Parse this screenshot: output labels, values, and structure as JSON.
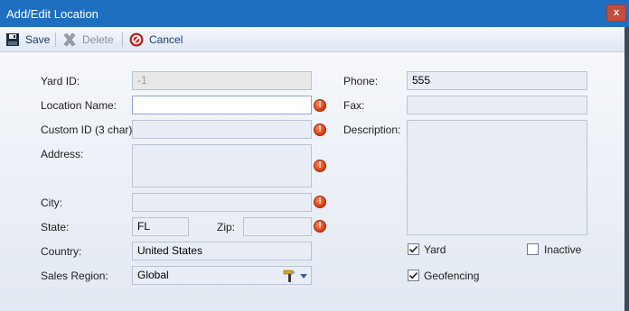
{
  "window": {
    "title": "Add/Edit Location",
    "close_label": "x"
  },
  "toolbar": {
    "save_label": "Save",
    "delete_label": "Delete",
    "cancel_label": "Cancel"
  },
  "form": {
    "yard_id": {
      "label": "Yard ID:",
      "value": "-1"
    },
    "location_name": {
      "label": "Location Name:",
      "value": ""
    },
    "custom_id": {
      "label": "Custom ID (3 char):",
      "value": ""
    },
    "address": {
      "label": "Address:",
      "value": ""
    },
    "city": {
      "label": "City:",
      "value": ""
    },
    "state": {
      "label": "State:",
      "value": "FL"
    },
    "zip": {
      "label": "Zip:",
      "value": ""
    },
    "country": {
      "label": "Country:",
      "value": "United States"
    },
    "sales_region": {
      "label": "Sales Region:",
      "value": "Global"
    },
    "phone": {
      "label": "Phone:",
      "value": "555"
    },
    "fax": {
      "label": "Fax:",
      "value": ""
    },
    "description": {
      "label": "Description:",
      "value": ""
    },
    "yard": {
      "label": "Yard",
      "checked": true
    },
    "inactive": {
      "label": "Inactive",
      "checked": false
    },
    "geofencing": {
      "label": "Geofencing",
      "checked": true
    }
  },
  "required_icon_glyph": "!",
  "colors": {
    "titlebar": "#1f6fc0",
    "required": "#d23a10",
    "accent_text": "#1a3a6a"
  }
}
